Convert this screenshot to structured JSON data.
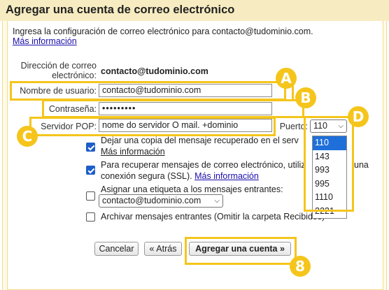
{
  "dialog": {
    "title": "Agregar una cuenta de correo electrónico",
    "intro": "Ingresa la configuración de correo electrónico para contacto@tudominio.com.",
    "more_info": "Más información"
  },
  "form": {
    "email_label_1": "Dirección de correo",
    "email_label_2": "electrónico:",
    "email_value": "contacto@tudominio.com",
    "username_label": "Nombre de usuario:",
    "username_value": "contacto@tudominio.com",
    "password_label": "Contraseña:",
    "password_value": "•••••••••",
    "pop_label": "Servidor POP:",
    "pop_value": "nome do servidor O mail. +dominio",
    "port_label": "Puerto:",
    "port_selected": "110",
    "port_options": [
      "110",
      "143",
      "993",
      "995",
      "1110",
      "2221"
    ]
  },
  "options": {
    "leave_copy_1": "Dejar una copia del mensaje recuperado en el serv",
    "leave_copy_2": "Más información",
    "leave_copy_checked": true,
    "ssl_1": "Para recuperar mensajes de correo electrónico, utiliz",
    "ssl_1_tail": "una",
    "ssl_2": "conexión segura (SSL).",
    "ssl_link": "Más información",
    "ssl_checked": true,
    "label_text": "Asignar una etiqueta a los mensajes entrantes:",
    "label_checked": false,
    "label_select": "contacto@tudominio.com",
    "archive_text": "Archivar mensajes entrantes (Omitir la carpeta Recibidos)",
    "archive_checked": false
  },
  "buttons": {
    "cancel": "Cancelar",
    "back": "« Atrás",
    "add": "Agregar una cuenta »"
  },
  "annotations": {
    "a": "A",
    "b": "B",
    "c": "C",
    "d": "D",
    "eight": "8",
    "color": "#f5c51c"
  }
}
